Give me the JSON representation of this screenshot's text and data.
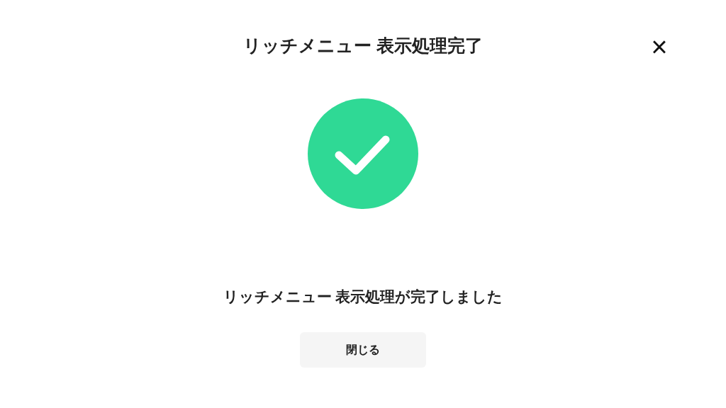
{
  "dialog": {
    "title": "リッチメニュー 表示処理完了",
    "close": "×",
    "message": "リッチメニュー 表示処理が完了しました",
    "buttons": [
      "閉じる"
    ]
  }
}
